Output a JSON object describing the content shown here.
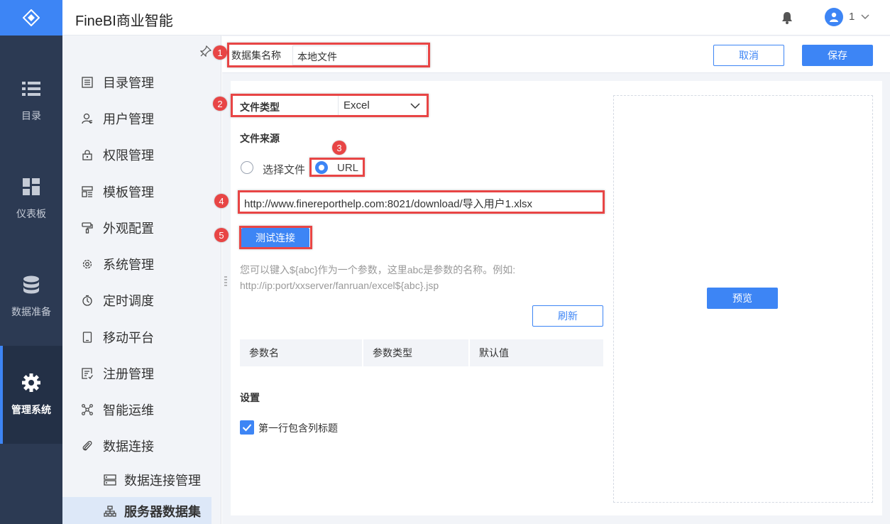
{
  "header": {
    "app_title": "FineBI商业智能",
    "user_label": "1",
    "icons": [
      "logo-icon",
      "bell-icon",
      "user-avatar-icon",
      "chevron-down-icon"
    ]
  },
  "rail": {
    "items": [
      {
        "label": "目录",
        "icon": "list-icon"
      },
      {
        "label": "仪表板",
        "icon": "dashboard-icon"
      },
      {
        "label": "数据准备",
        "icon": "database-icon"
      },
      {
        "label": "管理系统",
        "icon": "gear-icon",
        "active": true
      }
    ]
  },
  "menu": {
    "items": [
      {
        "label": "目录管理",
        "icon": "catalog-icon"
      },
      {
        "label": "用户管理",
        "icon": "user-icon"
      },
      {
        "label": "权限管理",
        "icon": "lock-icon"
      },
      {
        "label": "模板管理",
        "icon": "template-icon"
      },
      {
        "label": "外观配置",
        "icon": "paint-roller-icon"
      },
      {
        "label": "系统管理",
        "icon": "settings-icon"
      },
      {
        "label": "定时调度",
        "icon": "timer-icon"
      },
      {
        "label": "移动平台",
        "icon": "tablet-icon"
      },
      {
        "label": "注册管理",
        "icon": "register-icon"
      },
      {
        "label": "智能运维",
        "icon": "network-icon"
      },
      {
        "label": "数据连接",
        "icon": "paperclip-icon"
      }
    ],
    "sub_items": [
      {
        "label": "数据连接管理",
        "icon": "server-icon"
      },
      {
        "label": "服务器数据集",
        "icon": "org-chart-icon",
        "active": true
      }
    ]
  },
  "form": {
    "dataset_name_label": "数据集名称",
    "dataset_name_value": "本地文件",
    "cancel_label": "取消",
    "save_label": "保存",
    "file_type_label": "文件类型",
    "file_type_value": "Excel",
    "file_source_label": "文件来源",
    "radio_choose_file": "选择文件",
    "radio_url": "URL",
    "selected_source": "URL",
    "url_value": "http://www.finereporthelp.com:8021/download/导入用户1.xlsx",
    "test_connection_label": "测试连接",
    "hint_line1": "您可以键入${abc}作为一个参数，这里abc是参数的名称。例如:",
    "hint_line2": "http://ip:port/xxserver/fanruan/excel${abc}.jsp",
    "refresh_label": "刷新",
    "param_headers": [
      "参数名",
      "参数类型",
      "默认值"
    ],
    "settings_label": "设置",
    "first_row_header_label": "第一行包含列标题",
    "first_row_header_checked": true,
    "preview_label": "预览"
  },
  "annotations": [
    "1",
    "2",
    "3",
    "4",
    "5"
  ],
  "colors": {
    "accent": "#3d85f5",
    "rail_bg": "#2c3a53",
    "annotation_red": "#e84545"
  }
}
